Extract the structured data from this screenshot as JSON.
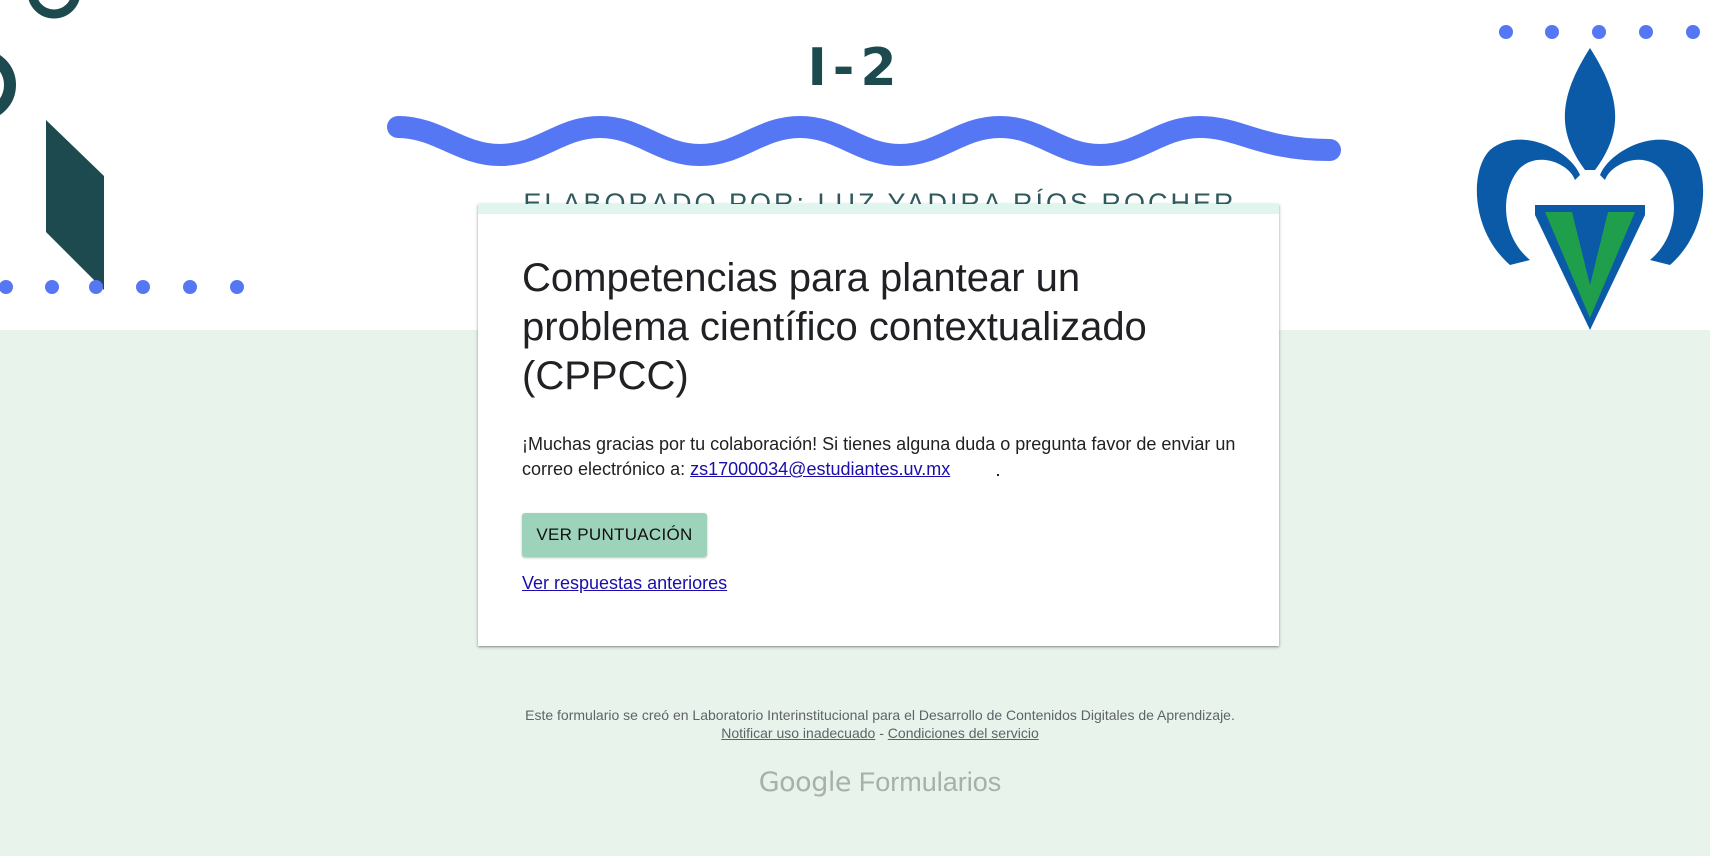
{
  "banner": {
    "code": "I-2",
    "author": "ELABORADO POR: LUZ YADIRA RÍOS ROCHER"
  },
  "form": {
    "title": "Competencias para plantear un problema científico contextualizado (CPPCC)",
    "message": "¡Muchas gracias por tu colaboración! Si tienes alguna duda o pregunta favor de enviar un correo electrónico a: ",
    "email": "zs17000034@estudiantes.uv.mx",
    "score_button": "VER PUNTUACIÓN",
    "previous_responses_link": "Ver respuestas anteriores"
  },
  "footer": {
    "creator_text": "Este formulario se creó en Laboratorio Interinstitucional para el Desarrollo de Contenidos Digitales de Aprendizaje.",
    "report_link": "Notificar uso inadecuado",
    "separator": " - ",
    "terms_link": "Condiciones del servicio",
    "brand_google": "Google",
    "brand_product": "Formularios"
  },
  "colors": {
    "page_background": "#e8f3ec",
    "wave": "#5577f3",
    "dots": "#5577f3",
    "dark_teal": "#1c4a4e",
    "logo_blue": "#0b5aa8",
    "logo_green": "#1f9f4c",
    "button": "#9dd3bb",
    "link": "#1a0dab"
  },
  "icons": [
    "university-logo-icon",
    "wave-decoration-icon"
  ]
}
